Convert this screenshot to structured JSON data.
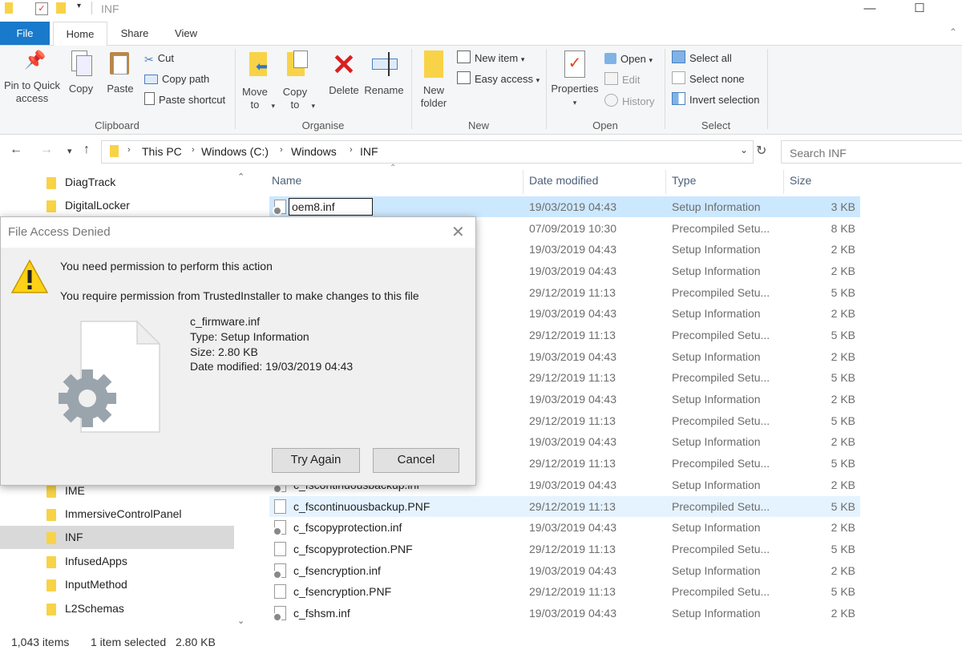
{
  "window": {
    "title": "INF"
  },
  "tabs": {
    "file": "File",
    "home": "Home",
    "share": "Share",
    "view": "View"
  },
  "ribbon": {
    "clipboard": {
      "pin": "Pin to Quick access",
      "copy": "Copy",
      "paste": "Paste",
      "cut": "Cut",
      "copy_path": "Copy path",
      "paste_shortcut": "Paste shortcut",
      "label": "Clipboard"
    },
    "organise": {
      "move_to": "Move to",
      "copy_to": "Copy to",
      "delete": "Delete",
      "rename": "Rename",
      "label": "Organise"
    },
    "new": {
      "new_folder": "New folder",
      "new_item": "New item",
      "easy_access": "Easy access",
      "label": "New"
    },
    "open": {
      "properties": "Properties",
      "open": "Open",
      "edit": "Edit",
      "history": "History",
      "label": "Open"
    },
    "select": {
      "select_all": "Select all",
      "select_none": "Select none",
      "invert": "Invert selection",
      "label": "Select"
    }
  },
  "address": {
    "crumbs": [
      "This PC",
      "Windows (C:)",
      "Windows",
      "INF"
    ]
  },
  "search": {
    "placeholder": "Search INF"
  },
  "nav": {
    "items": [
      "DiagTrack",
      "DigitalLocker",
      "IME",
      "ImmersiveControlPanel",
      "INF",
      "InfusedApps",
      "InputMethod",
      "L2Schemas"
    ],
    "selected": "INF"
  },
  "columns": {
    "name": "Name",
    "date": "Date modified",
    "type": "Type",
    "size": "Size"
  },
  "files": [
    {
      "name": "oem8.inf",
      "date": "19/03/2019 04:43",
      "type": "Setup Information",
      "size": "3 KB"
    },
    {
      "name": "",
      "date": "07/09/2019 10:30",
      "type": "Precompiled Setu...",
      "size": "8 KB"
    },
    {
      "name": "",
      "date": "19/03/2019 04:43",
      "type": "Setup Information",
      "size": "2 KB"
    },
    {
      "name": "",
      "date": "19/03/2019 04:43",
      "type": "Setup Information",
      "size": "2 KB"
    },
    {
      "name": "",
      "date": "29/12/2019 11:13",
      "type": "Precompiled Setu...",
      "size": "5 KB"
    },
    {
      "name": "",
      "date": "19/03/2019 04:43",
      "type": "Setup Information",
      "size": "2 KB"
    },
    {
      "name": "",
      "date": "29/12/2019 11:13",
      "type": "Precompiled Setu...",
      "size": "5 KB"
    },
    {
      "name": "",
      "date": "19/03/2019 04:43",
      "type": "Setup Information",
      "size": "2 KB"
    },
    {
      "name": "",
      "date": "29/12/2019 11:13",
      "type": "Precompiled Setu...",
      "size": "5 KB"
    },
    {
      "name": "",
      "date": "19/03/2019 04:43",
      "type": "Setup Information",
      "size": "2 KB"
    },
    {
      "name": "",
      "date": "29/12/2019 11:13",
      "type": "Precompiled Setu...",
      "size": "5 KB"
    },
    {
      "name": "",
      "date": "19/03/2019 04:43",
      "type": "Setup Information",
      "size": "2 KB"
    },
    {
      "name": "",
      "date": "29/12/2019 11:13",
      "type": "Precompiled Setu...",
      "size": "5 KB"
    },
    {
      "name": "c_fscontinuousbackup.inf",
      "date": "19/03/2019 04:43",
      "type": "Setup Information",
      "size": "2 KB"
    },
    {
      "name": "c_fscontinuousbackup.PNF",
      "date": "29/12/2019 11:13",
      "type": "Precompiled Setu...",
      "size": "5 KB"
    },
    {
      "name": "c_fscopyprotection.inf",
      "date": "19/03/2019 04:43",
      "type": "Setup Information",
      "size": "2 KB"
    },
    {
      "name": "c_fscopyprotection.PNF",
      "date": "29/12/2019 11:13",
      "type": "Precompiled Setu...",
      "size": "5 KB"
    },
    {
      "name": "c_fsencryption.inf",
      "date": "19/03/2019 04:43",
      "type": "Setup Information",
      "size": "2 KB"
    },
    {
      "name": "c_fsencryption.PNF",
      "date": "29/12/2019 11:13",
      "type": "Precompiled Setu...",
      "size": "5 KB"
    },
    {
      "name": "c_fshsm.inf",
      "date": "19/03/2019 04:43",
      "type": "Setup Information",
      "size": "2 KB"
    }
  ],
  "status": {
    "count": "1,043 items",
    "selection": "1 item selected",
    "size": "2.80 KB"
  },
  "dialog": {
    "title": "File Access Denied",
    "message": "You need permission to perform this action",
    "detail": "You require permission from TrustedInstaller to make changes to this file",
    "file_name": "c_firmware.inf",
    "file_type": "Type: Setup Information",
    "file_size": "Size: 2.80 KB",
    "file_date": "Date modified: 19/03/2019 04:43",
    "try_again": "Try Again",
    "cancel": "Cancel"
  },
  "colors": {
    "accent": "#1979ca",
    "selection": "#cce8ff",
    "folder": "#f8d347"
  }
}
